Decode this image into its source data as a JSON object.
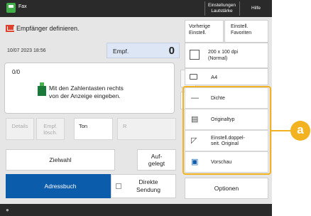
{
  "topbar": {
    "app_name": "Fax",
    "settings_label_line1": "Einstellungen",
    "settings_label_line2": "Lautstärke",
    "help_label": "Hilfe"
  },
  "title": "Empfänger definieren.",
  "datetime": "10/07 2023 18:56",
  "recipients": {
    "label": "Empf.",
    "count": "0"
  },
  "message": {
    "count": "0/0",
    "line1": "Mit den Zahlentasten rechts",
    "line2": "von der Anzeige eingeben."
  },
  "scroll": {
    "up": "▲",
    "down": "▼"
  },
  "small_buttons": {
    "details": "Details",
    "delete_line1": "Empf.",
    "delete_line2": "lösch.",
    "ton": "Ton",
    "r": "R"
  },
  "buttons": {
    "zielwahl": "Zielwahl",
    "aufgelegt_line1": "Auf-",
    "aufgelegt_line2": "gelegt",
    "adressbuch": "Adressbuch",
    "direkte_line1": "Direkte",
    "direkte_line2": "Sendung",
    "optionen": "Optionen"
  },
  "right": {
    "vorherige_line1": "Vorherige",
    "vorherige_line2": "Einstell.",
    "favoriten_line1": "Einstell.",
    "favoriten_line2": "Favoriten",
    "resolution_line1": "200 x 100 dpi",
    "resolution_line2": "(Normal)",
    "size": "A4",
    "dichte": "Dichte",
    "originaltyp": "Originaltyp",
    "doppelseit_line1": "Einstell.doppel-",
    "doppelseit_line2": "seit. Original",
    "vorschau": "Vorschau"
  },
  "callout_label": "a",
  "colors": {
    "accent_blue": "#0b5cab",
    "highlight_orange": "#f3b321",
    "title_icon_red": "#e0402e",
    "app_icon_green": "#3fae49"
  }
}
